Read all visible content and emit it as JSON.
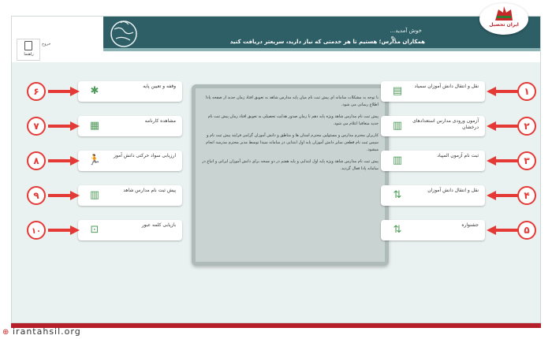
{
  "header": {
    "greeting": "خوش آمدید...",
    "subline": "همکاران مدارس؛ هستیم تا هر خدمتی که نیاز دارید، سریعتر دریافت کنید",
    "logout_label": "خروج",
    "guide_label": "راهنما"
  },
  "right_menu": [
    {
      "num": "۱",
      "label": "نقل و انتقال دانش آموزان سمیاد",
      "icon": "document-icon"
    },
    {
      "num": "۲",
      "label": "آزمون ورودی مدارس استعدادهای درخشان",
      "icon": "school-icon"
    },
    {
      "num": "۳",
      "label": "ثبت نام آزمون المپیاد",
      "icon": "school-icon"
    },
    {
      "num": "۴",
      "label": "نقل و انتقال دانش آموزان",
      "icon": "transfer-icon"
    },
    {
      "num": "۵",
      "label": "جشنواره",
      "icon": "transfer-icon"
    }
  ],
  "left_menu": [
    {
      "num": "۶",
      "label": "وقفه و تعیین پایه",
      "icon": "graduation-icon"
    },
    {
      "num": "۷",
      "label": "مشاهده کارنامه",
      "icon": "certificate-icon"
    },
    {
      "num": "۸",
      "label": "ارزیابی سواد حرکتی دانش آموز",
      "icon": "running-icon"
    },
    {
      "num": "۹",
      "label": "پیش ثبت نام مدارس شاهد",
      "icon": "school-icon"
    },
    {
      "num": "۱۰",
      "label": "بازیابی کلمه عبور",
      "icon": "lock-icon"
    }
  ],
  "panel": {
    "p1": "با توجه به مشکلات سامانه ای پیش ثبت نام میان پایه مدارس شاهد به تعویق افتاد زمان جدید از صفحه پادا اطلاع رسانی می شود.",
    "p2": "پیش ثبت نام مدارس شاهد ویژه پایه دهم تا زمان صدور هدایت تحصیلی به تعویق افتاد زمان پیش ثبت نام جدید متعاقبا اعلام می شود.",
    "p3": "کاربران محترم مدارس و مسئولین محترم استان ها و مناطق و دانش آموزان گرامی فرایند پیش ثبت نام و سپس ثبت نام قطعی سایر دانش آموزان پایه اول ابتدایی در سامانه سیدا توسط مدیر محترم مدرسه انجام میشود.",
    "p4": "پیش ثبت نام مدارس شاهد ویژه پایه اول ابتدایی و پایه هفتم در دو نسخه برای دانش آموزان ایرانی و اتباع در سامانه پادا فعال گردید."
  },
  "footer": {
    "url": "irantahsil.org"
  },
  "logo": {
    "text": "ایران تحصیل"
  },
  "colors": {
    "accent_red": "#e53935",
    "teal": "#2e5e66",
    "icon_green": "#4e9a58"
  }
}
